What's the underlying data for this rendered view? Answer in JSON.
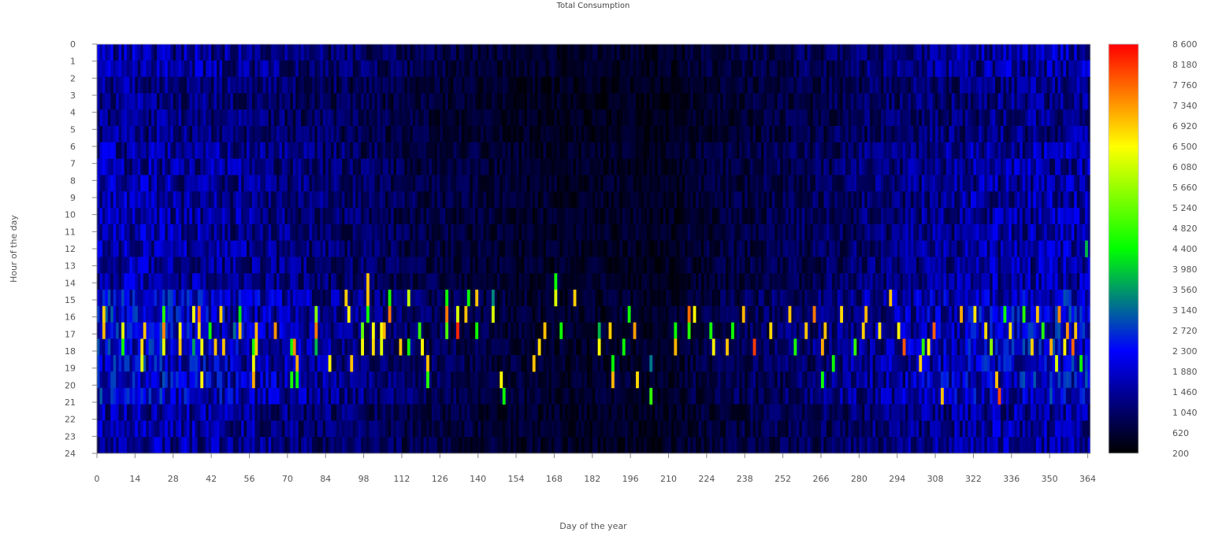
{
  "chart_data": {
    "type": "heatmap",
    "title": "Total Consumption",
    "xlabel": "Day of the year",
    "ylabel": "Hour of the day",
    "x_range": [
      0,
      365
    ],
    "y_range": [
      0,
      24
    ],
    "x_ticks": [
      "0",
      "14",
      "28",
      "42",
      "56",
      "70",
      "84",
      "98",
      "112",
      "126",
      "140",
      "154",
      "168",
      "182",
      "196",
      "210",
      "224",
      "238",
      "252",
      "266",
      "280",
      "294",
      "308",
      "322",
      "336",
      "350",
      "364"
    ],
    "y_ticks": [
      "0",
      "1",
      "2",
      "3",
      "4",
      "5",
      "6",
      "7",
      "8",
      "9",
      "10",
      "11",
      "12",
      "13",
      "14",
      "15",
      "16",
      "17",
      "18",
      "19",
      "20",
      "21",
      "22",
      "23",
      "24"
    ],
    "colorbar": {
      "min": 200,
      "max": 8600,
      "ticks": [
        "8 600",
        "8 180",
        "7 760",
        "7 340",
        "6 920",
        "6 500",
        "6 080",
        "5 660",
        "5 240",
        "4 820",
        "4 400",
        "3 980",
        "3 560",
        "3 140",
        "2 720",
        "2 300",
        "1 880",
        "1 460",
        "1 040",
        "620",
        "200"
      ],
      "colors": [
        "#000000",
        "#0000ff",
        "#00ff00",
        "#ffff00",
        "#ff0000"
      ]
    },
    "baseline_description": "Mostly low values (~600-1900) across all days and hours; peaks up to ~8600 concentrated in evening hours 15-21",
    "peaks": [
      {
        "day": 2,
        "hour": 16,
        "value": 6900
      },
      {
        "day": 2,
        "hour": 17,
        "value": 7100
      },
      {
        "day": 9,
        "hour": 17,
        "value": 6200
      },
      {
        "day": 9,
        "hour": 18,
        "value": 4500
      },
      {
        "day": 16,
        "hour": 18,
        "value": 6800
      },
      {
        "day": 16,
        "hour": 19,
        "value": 6200
      },
      {
        "day": 17,
        "hour": 17,
        "value": 7000
      },
      {
        "day": 24,
        "hour": 16,
        "value": 4700
      },
      {
        "day": 24,
        "hour": 17,
        "value": 7500
      },
      {
        "day": 24,
        "hour": 18,
        "value": 6300
      },
      {
        "day": 30,
        "hour": 17,
        "value": 6600
      },
      {
        "day": 30,
        "hour": 18,
        "value": 7000
      },
      {
        "day": 35,
        "hour": 16,
        "value": 6500
      },
      {
        "day": 35,
        "hour": 18,
        "value": 3600
      },
      {
        "day": 37,
        "hour": 16,
        "value": 7700
      },
      {
        "day": 37,
        "hour": 17,
        "value": 6800
      },
      {
        "day": 38,
        "hour": 18,
        "value": 6400
      },
      {
        "day": 38,
        "hour": 20,
        "value": 6500
      },
      {
        "day": 41,
        "hour": 17,
        "value": 4500
      },
      {
        "day": 43,
        "hour": 18,
        "value": 7000
      },
      {
        "day": 45,
        "hour": 16,
        "value": 6900
      },
      {
        "day": 46,
        "hour": 18,
        "value": 7000
      },
      {
        "day": 50,
        "hour": 17,
        "value": 3200
      },
      {
        "day": 52,
        "hour": 16,
        "value": 4200
      },
      {
        "day": 52,
        "hour": 17,
        "value": 7000
      },
      {
        "day": 57,
        "hour": 18,
        "value": 4600
      },
      {
        "day": 57,
        "hour": 19,
        "value": 6400
      },
      {
        "day": 57,
        "hour": 20,
        "value": 7200
      },
      {
        "day": 58,
        "hour": 17,
        "value": 7100
      },
      {
        "day": 58,
        "hour": 18,
        "value": 6900
      },
      {
        "day": 65,
        "hour": 17,
        "value": 7400
      },
      {
        "day": 71,
        "hour": 18,
        "value": 4500
      },
      {
        "day": 71,
        "hour": 20,
        "value": 4600
      },
      {
        "day": 72,
        "hour": 18,
        "value": 7500
      },
      {
        "day": 73,
        "hour": 19,
        "value": 7200
      },
      {
        "day": 73,
        "hour": 20,
        "value": 4400
      },
      {
        "day": 80,
        "hour": 16,
        "value": 5500
      },
      {
        "day": 80,
        "hour": 17,
        "value": 7600
      },
      {
        "day": 80,
        "hour": 18,
        "value": 3800
      },
      {
        "day": 85,
        "hour": 19,
        "value": 6600
      },
      {
        "day": 91,
        "hour": 15,
        "value": 6900
      },
      {
        "day": 92,
        "hour": 16,
        "value": 6600
      },
      {
        "day": 93,
        "hour": 19,
        "value": 7000
      },
      {
        "day": 97,
        "hour": 17,
        "value": 5200
      },
      {
        "day": 97,
        "hour": 18,
        "value": 6400
      },
      {
        "day": 99,
        "hour": 14,
        "value": 7000
      },
      {
        "day": 99,
        "hour": 15,
        "value": 7000
      },
      {
        "day": 99,
        "hour": 16,
        "value": 4500
      },
      {
        "day": 101,
        "hour": 17,
        "value": 6500
      },
      {
        "day": 101,
        "hour": 18,
        "value": 6800
      },
      {
        "day": 104,
        "hour": 17,
        "value": 6400
      },
      {
        "day": 104,
        "hour": 18,
        "value": 6200
      },
      {
        "day": 105,
        "hour": 17,
        "value": 7100
      },
      {
        "day": 107,
        "hour": 15,
        "value": 4600
      },
      {
        "day": 107,
        "hour": 16,
        "value": 7600
      },
      {
        "day": 111,
        "hour": 18,
        "value": 7000
      },
      {
        "day": 114,
        "hour": 15,
        "value": 6000
      },
      {
        "day": 114,
        "hour": 18,
        "value": 4500
      },
      {
        "day": 118,
        "hour": 17,
        "value": 4800
      },
      {
        "day": 119,
        "hour": 18,
        "value": 6500
      },
      {
        "day": 121,
        "hour": 19,
        "value": 7000
      },
      {
        "day": 121,
        "hour": 20,
        "value": 4700
      },
      {
        "day": 128,
        "hour": 15,
        "value": 4500
      },
      {
        "day": 128,
        "hour": 16,
        "value": 7600
      },
      {
        "day": 128,
        "hour": 17,
        "value": 5000
      },
      {
        "day": 132,
        "hour": 16,
        "value": 6200
      },
      {
        "day": 132,
        "hour": 17,
        "value": 8300
      },
      {
        "day": 135,
        "hour": 16,
        "value": 7000
      },
      {
        "day": 136,
        "hour": 15,
        "value": 4500
      },
      {
        "day": 139,
        "hour": 15,
        "value": 7000
      },
      {
        "day": 139,
        "hour": 17,
        "value": 4500
      },
      {
        "day": 145,
        "hour": 15,
        "value": 3400
      },
      {
        "day": 145,
        "hour": 16,
        "value": 6200
      },
      {
        "day": 148,
        "hour": 20,
        "value": 6500
      },
      {
        "day": 149,
        "hour": 21,
        "value": 4500
      },
      {
        "day": 160,
        "hour": 19,
        "value": 7000
      },
      {
        "day": 162,
        "hour": 18,
        "value": 6800
      },
      {
        "day": 164,
        "hour": 17,
        "value": 7000
      },
      {
        "day": 168,
        "hour": 14,
        "value": 4500
      },
      {
        "day": 168,
        "hour": 15,
        "value": 6200
      },
      {
        "day": 170,
        "hour": 17,
        "value": 4500
      },
      {
        "day": 175,
        "hour": 15,
        "value": 6900
      },
      {
        "day": 184,
        "hour": 17,
        "value": 3800
      },
      {
        "day": 184,
        "hour": 18,
        "value": 6500
      },
      {
        "day": 188,
        "hour": 17,
        "value": 6900
      },
      {
        "day": 189,
        "hour": 19,
        "value": 4400
      },
      {
        "day": 189,
        "hour": 20,
        "value": 7100
      },
      {
        "day": 193,
        "hour": 18,
        "value": 4500
      },
      {
        "day": 195,
        "hour": 16,
        "value": 4500
      },
      {
        "day": 197,
        "hour": 17,
        "value": 7300
      },
      {
        "day": 198,
        "hour": 20,
        "value": 6800
      },
      {
        "day": 203,
        "hour": 19,
        "value": 3300
      },
      {
        "day": 203,
        "hour": 21,
        "value": 4800
      },
      {
        "day": 212,
        "hour": 17,
        "value": 4500
      },
      {
        "day": 212,
        "hour": 18,
        "value": 7100
      },
      {
        "day": 217,
        "hour": 16,
        "value": 7700
      },
      {
        "day": 217,
        "hour": 17,
        "value": 4700
      },
      {
        "day": 219,
        "hour": 16,
        "value": 6500
      },
      {
        "day": 225,
        "hour": 17,
        "value": 4600
      },
      {
        "day": 226,
        "hour": 18,
        "value": 6600
      },
      {
        "day": 231,
        "hour": 18,
        "value": 7000
      },
      {
        "day": 233,
        "hour": 17,
        "value": 4500
      },
      {
        "day": 237,
        "hour": 16,
        "value": 7100
      },
      {
        "day": 241,
        "hour": 18,
        "value": 8100
      },
      {
        "day": 247,
        "hour": 17,
        "value": 6800
      },
      {
        "day": 254,
        "hour": 16,
        "value": 7000
      },
      {
        "day": 256,
        "hour": 18,
        "value": 4600
      },
      {
        "day": 260,
        "hour": 17,
        "value": 7000
      },
      {
        "day": 263,
        "hour": 16,
        "value": 7600
      },
      {
        "day": 266,
        "hour": 18,
        "value": 7200
      },
      {
        "day": 266,
        "hour": 20,
        "value": 4500
      },
      {
        "day": 267,
        "hour": 17,
        "value": 7000
      },
      {
        "day": 270,
        "hour": 19,
        "value": 4500
      },
      {
        "day": 273,
        "hour": 16,
        "value": 6800
      },
      {
        "day": 278,
        "hour": 18,
        "value": 4800
      },
      {
        "day": 281,
        "hour": 17,
        "value": 6900
      },
      {
        "day": 282,
        "hour": 16,
        "value": 7100
      },
      {
        "day": 287,
        "hour": 17,
        "value": 6700
      },
      {
        "day": 291,
        "hour": 15,
        "value": 7000
      },
      {
        "day": 294,
        "hour": 17,
        "value": 6600
      },
      {
        "day": 296,
        "hour": 18,
        "value": 7900
      },
      {
        "day": 302,
        "hour": 19,
        "value": 6900
      },
      {
        "day": 303,
        "hour": 18,
        "value": 4700
      },
      {
        "day": 305,
        "hour": 18,
        "value": 6600
      },
      {
        "day": 307,
        "hour": 17,
        "value": 7800
      },
      {
        "day": 310,
        "hour": 21,
        "value": 7000
      },
      {
        "day": 317,
        "hour": 16,
        "value": 7200
      },
      {
        "day": 322,
        "hour": 16,
        "value": 6700
      },
      {
        "day": 326,
        "hour": 17,
        "value": 6800
      },
      {
        "day": 328,
        "hour": 18,
        "value": 5500
      },
      {
        "day": 330,
        "hour": 20,
        "value": 7000
      },
      {
        "day": 331,
        "hour": 21,
        "value": 8000
      },
      {
        "day": 333,
        "hour": 16,
        "value": 4500
      },
      {
        "day": 335,
        "hour": 17,
        "value": 6800
      },
      {
        "day": 340,
        "hour": 16,
        "value": 4700
      },
      {
        "day": 343,
        "hour": 18,
        "value": 6900
      },
      {
        "day": 345,
        "hour": 16,
        "value": 7000
      },
      {
        "day": 347,
        "hour": 17,
        "value": 4700
      },
      {
        "day": 350,
        "hour": 18,
        "value": 7200
      },
      {
        "day": 352,
        "hour": 19,
        "value": 6200
      },
      {
        "day": 353,
        "hour": 16,
        "value": 7500
      },
      {
        "day": 355,
        "hour": 18,
        "value": 6600
      },
      {
        "day": 356,
        "hour": 17,
        "value": 7400
      },
      {
        "day": 358,
        "hour": 18,
        "value": 7800
      },
      {
        "day": 359,
        "hour": 17,
        "value": 7000
      },
      {
        "day": 361,
        "hour": 19,
        "value": 4500
      },
      {
        "day": 363,
        "hour": 12,
        "value": 3800
      }
    ]
  }
}
